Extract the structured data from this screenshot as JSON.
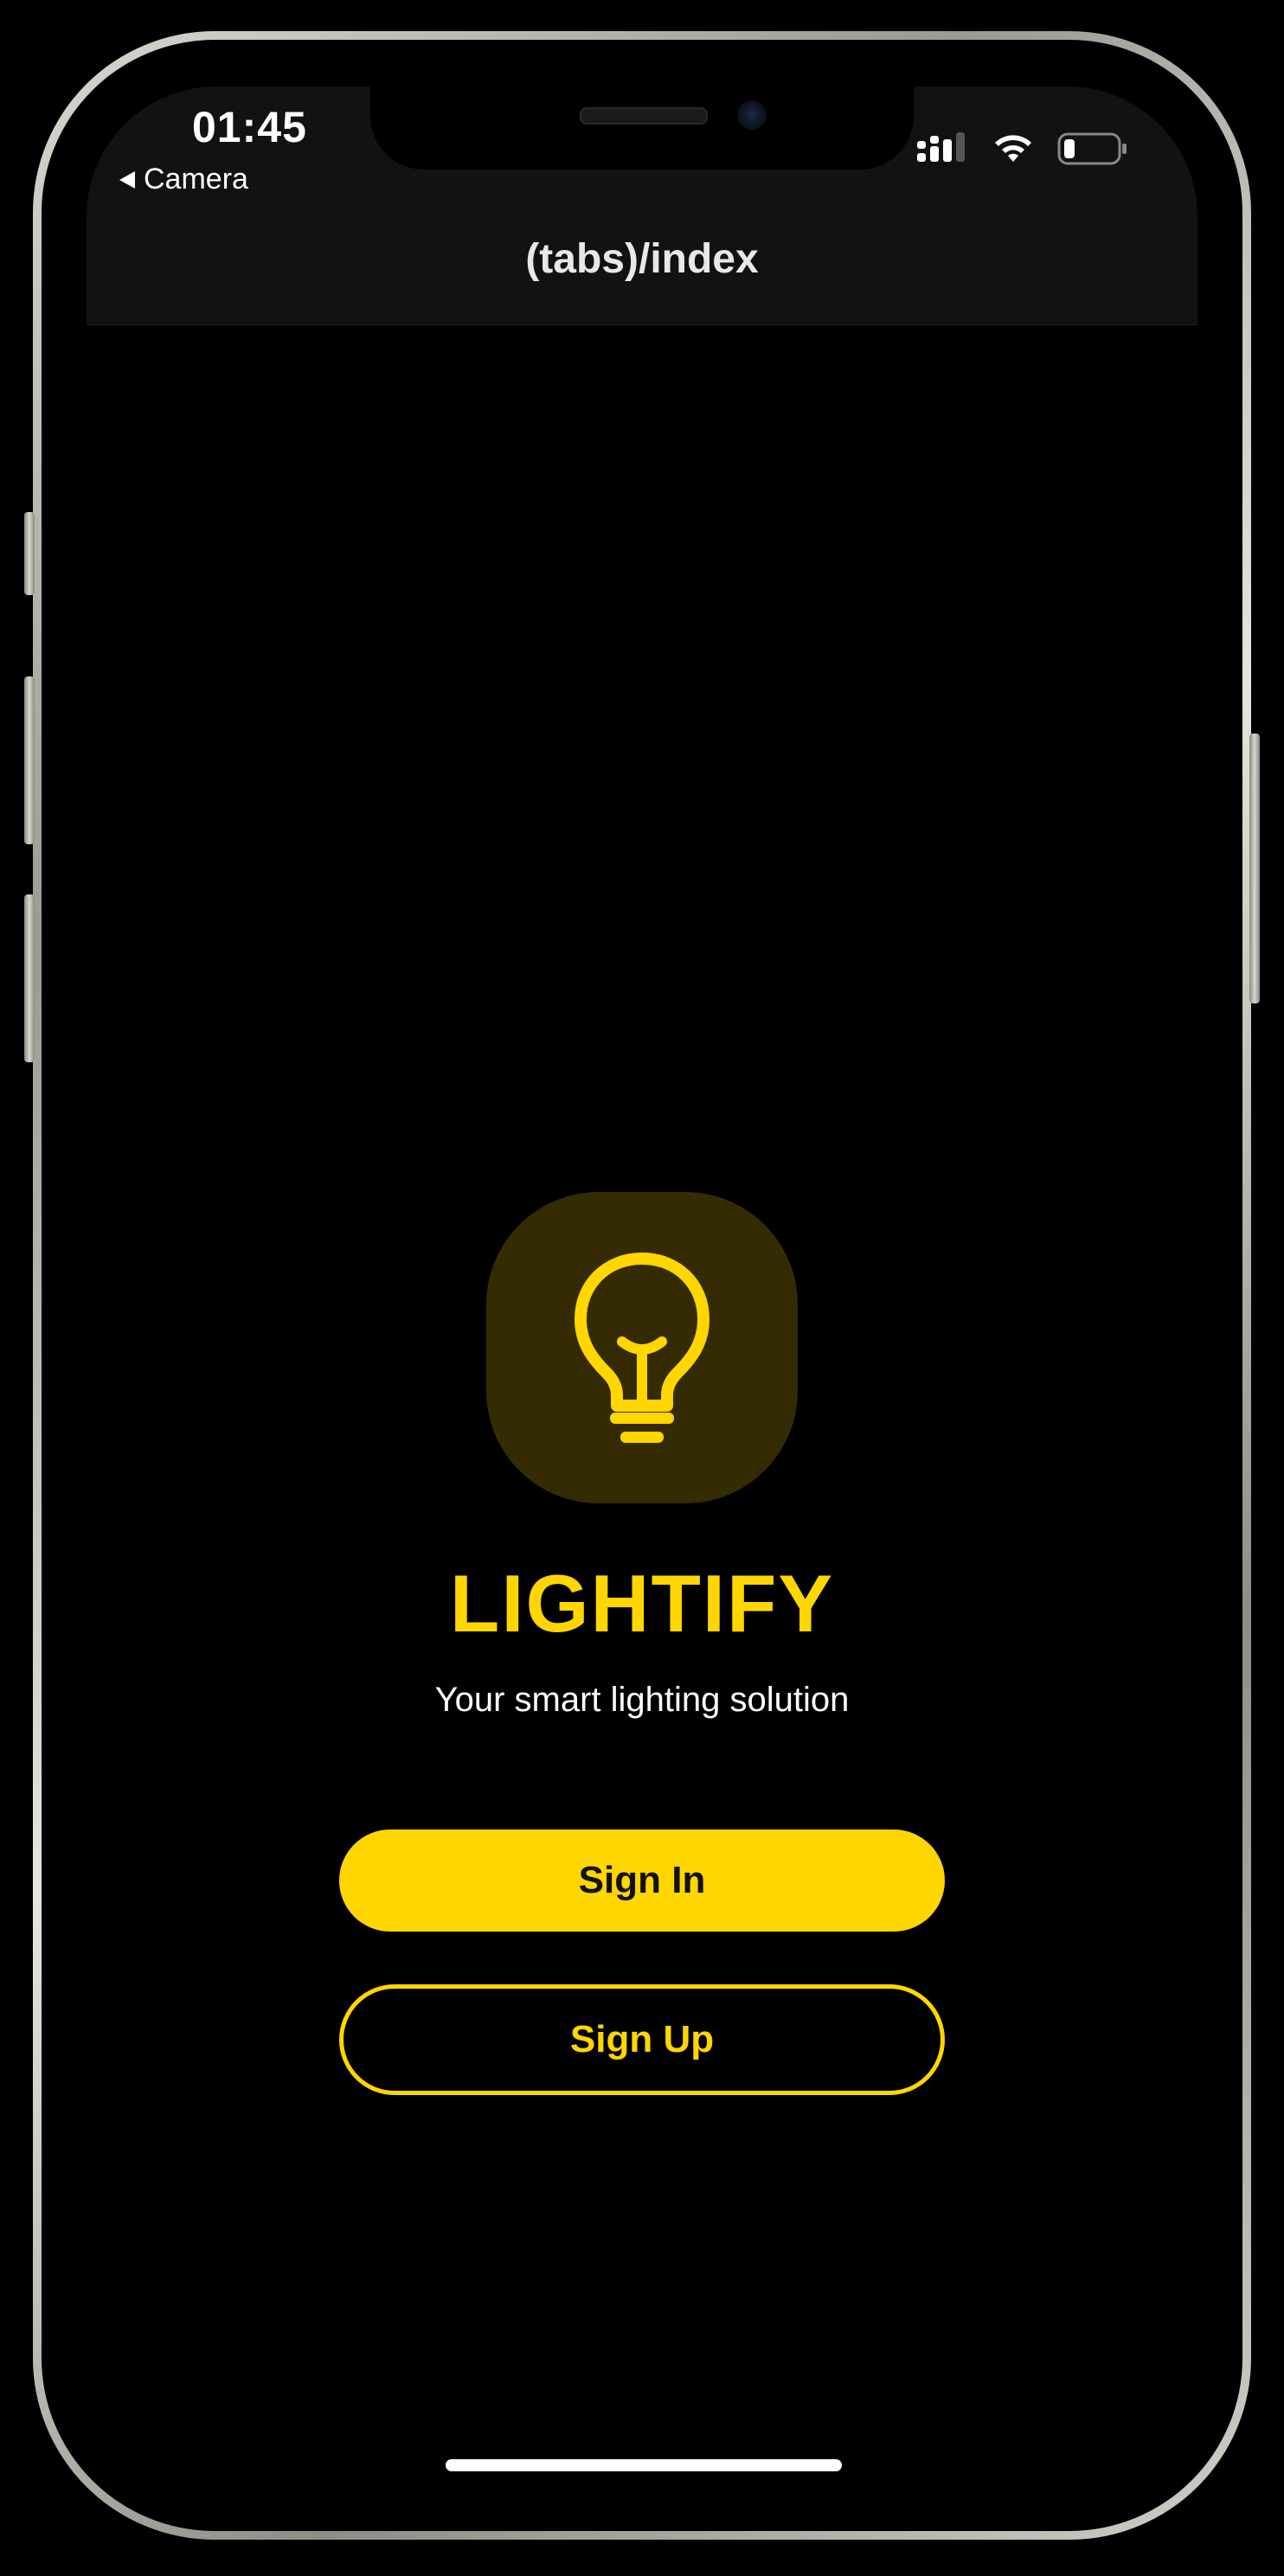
{
  "status_bar": {
    "time": "01:45",
    "back_label": "Camera",
    "icons": [
      "signal-icon",
      "wifi-icon",
      "battery-icon"
    ]
  },
  "nav": {
    "title": "(tabs)/index"
  },
  "hero": {
    "icon": "lightbulb-icon",
    "title": "LIGHTIFY",
    "tagline": "Your smart lighting solution"
  },
  "actions": {
    "sign_in_label": "Sign In",
    "sign_up_label": "Sign Up"
  },
  "colors": {
    "accent": "#ffd600",
    "icon_bg": "#352b02",
    "background": "#000000",
    "header_bg": "#121212"
  }
}
